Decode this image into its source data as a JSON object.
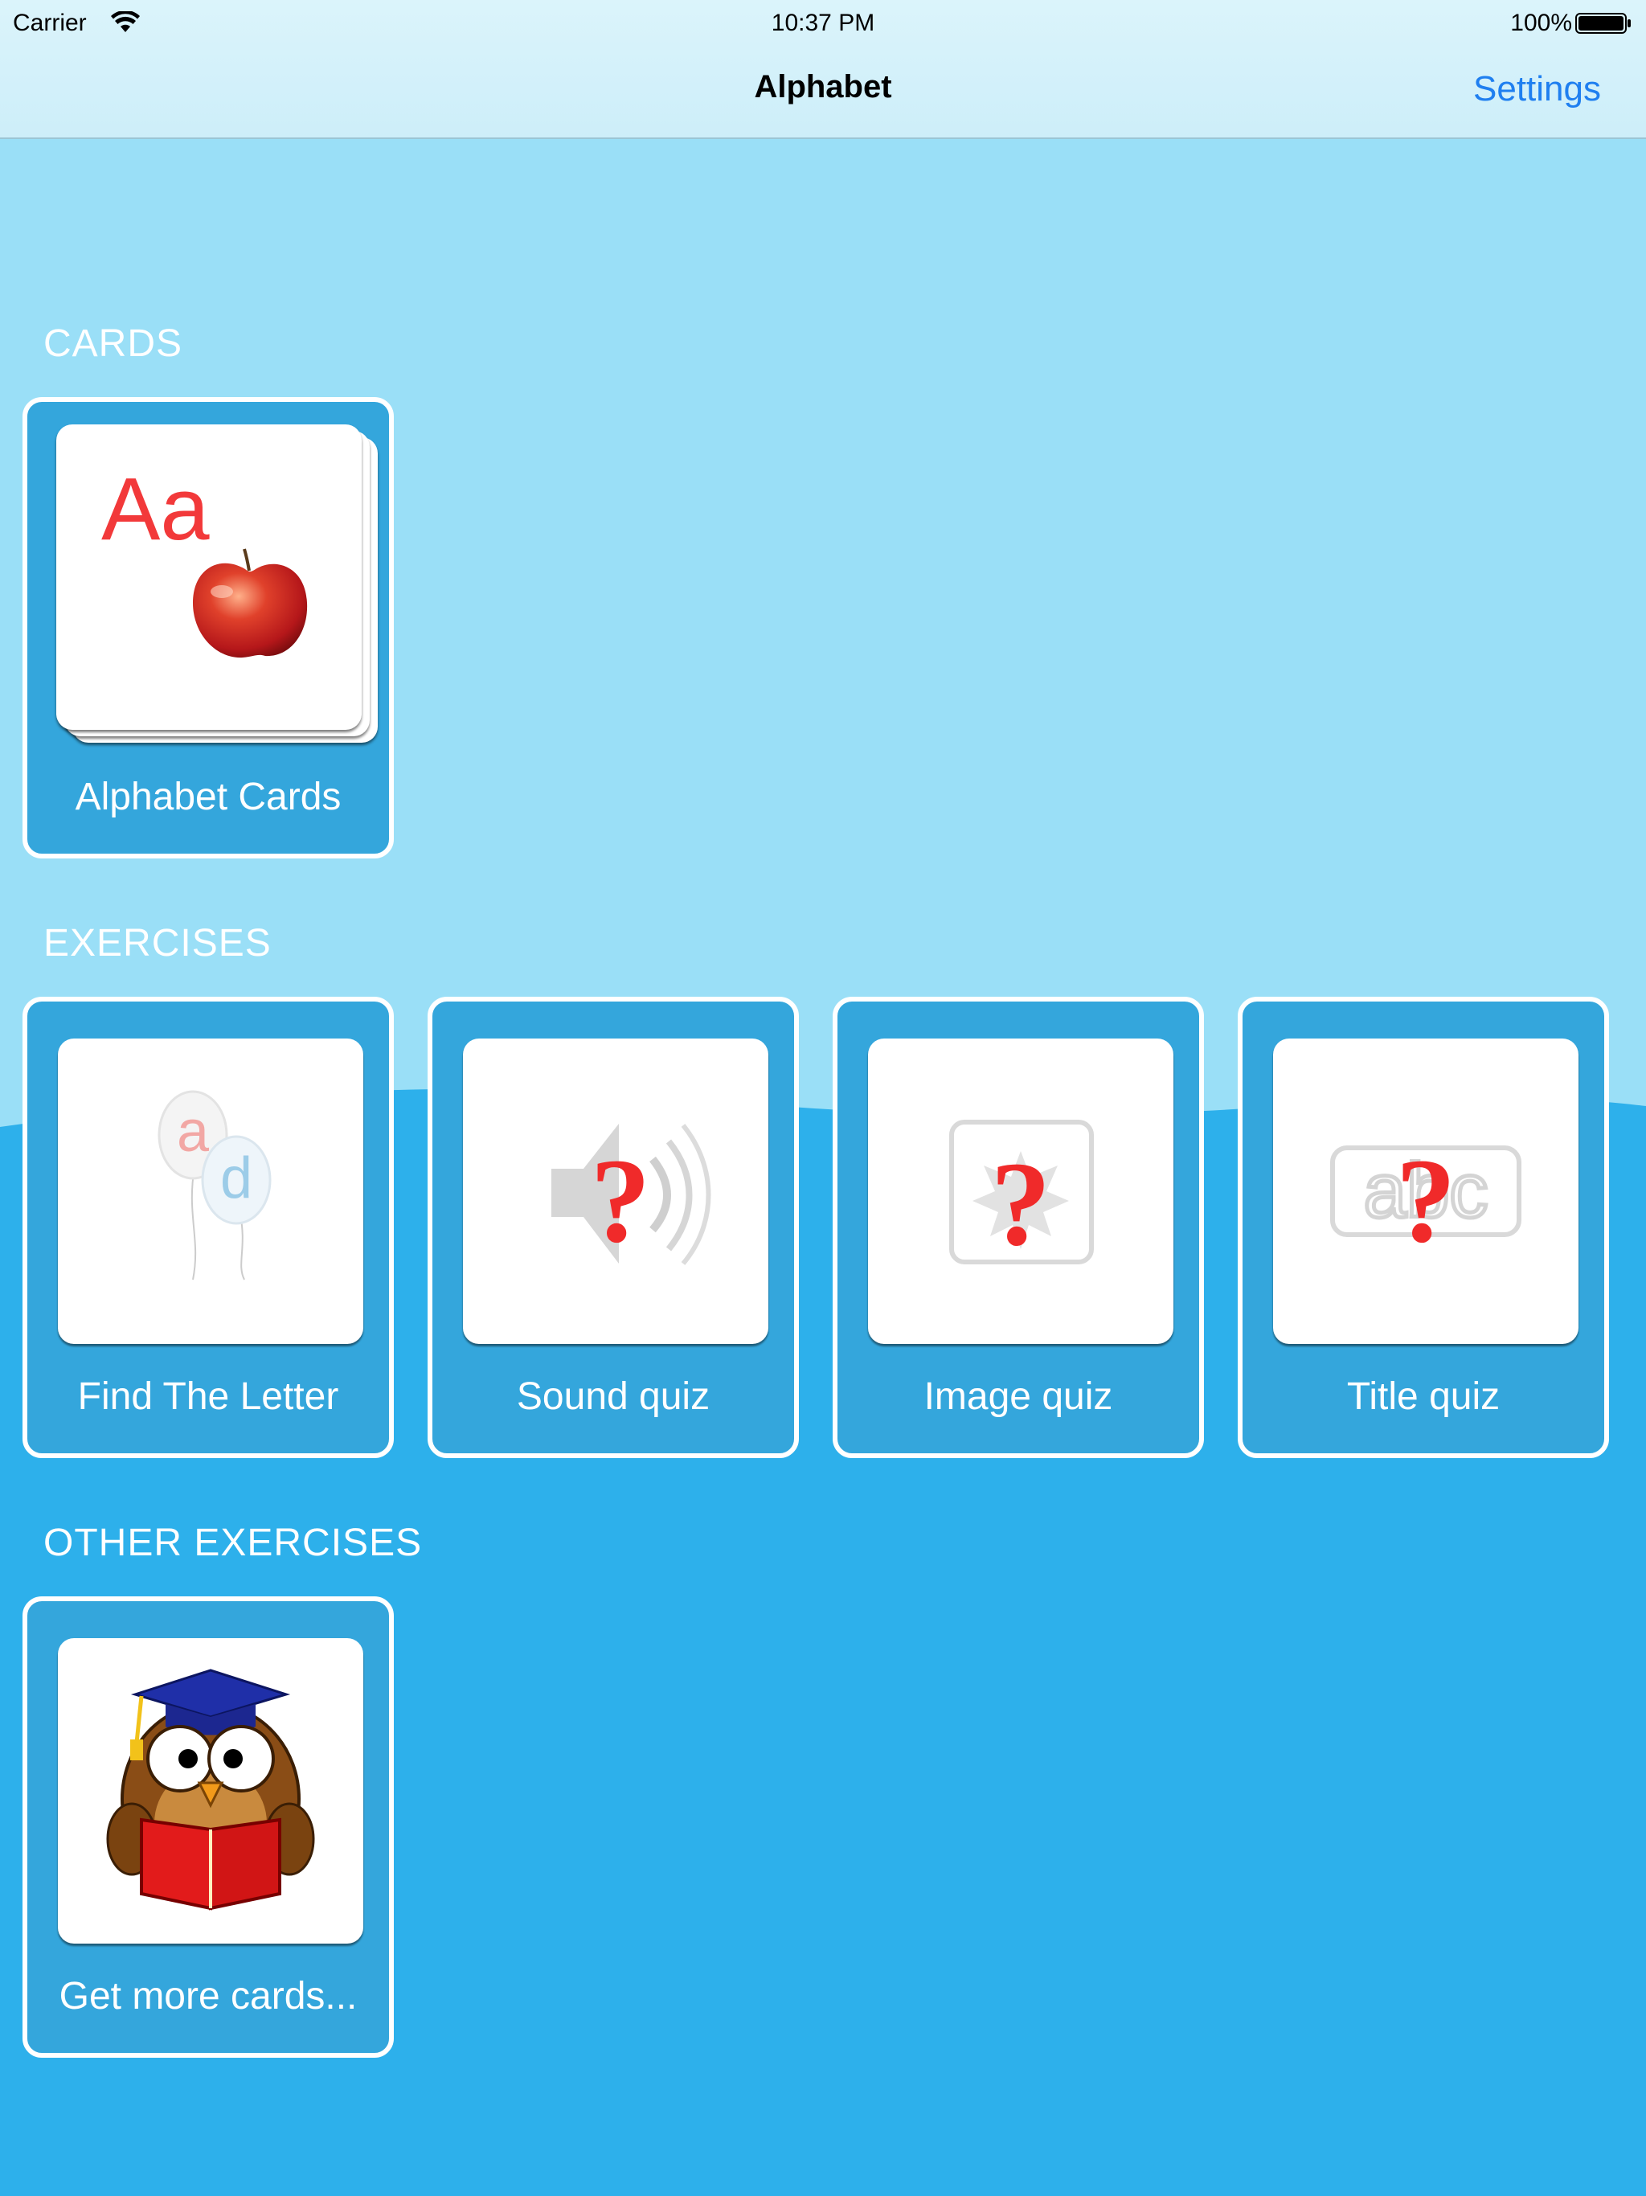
{
  "status_bar": {
    "carrier": "Carrier",
    "time": "10:37 PM",
    "battery": "100%"
  },
  "nav": {
    "title": "Alphabet",
    "settings_label": "Settings"
  },
  "sections": {
    "cards": {
      "header": "CARDS",
      "items": [
        {
          "label": "Alphabet Cards",
          "card_text": "Aa",
          "icon": "apple-icon"
        }
      ]
    },
    "exercises": {
      "header": "EXERCISES",
      "items": [
        {
          "label": "Find The Letter",
          "icon": "balloons-icon",
          "letters": [
            "a",
            "d"
          ]
        },
        {
          "label": "Sound quiz",
          "icon": "speaker-question-icon"
        },
        {
          "label": "Image quiz",
          "icon": "image-question-icon"
        },
        {
          "label": "Title quiz",
          "icon": "abc-question-icon",
          "text": "abc"
        }
      ]
    },
    "other_exercises": {
      "header": "OTHER EXERCISES",
      "items": [
        {
          "label": "Get more cards...",
          "icon": "owl-reading-icon"
        }
      ]
    }
  },
  "colors": {
    "sky": "#9adff7",
    "water": "#2db0eb",
    "tile": "#34a6dc",
    "accent_link": "#1f7ff0",
    "question_mark": "#f02a2a"
  }
}
